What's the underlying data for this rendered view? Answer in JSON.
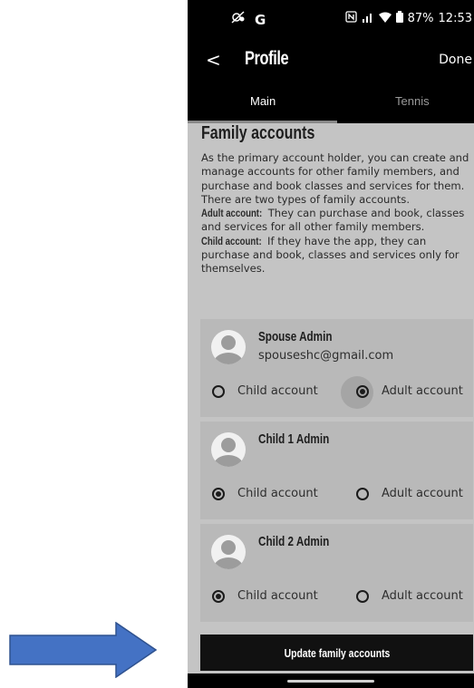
{
  "status_bar": {
    "left_icons": [
      "notification-muted-icon",
      "google-icon"
    ],
    "google_letter": "G",
    "battery": "87%",
    "time": "12:53"
  },
  "header": {
    "back_glyph": "<",
    "title": "Profile",
    "done_label": "Done"
  },
  "tabs": [
    {
      "label": "Main",
      "active": true
    },
    {
      "label": "Tennis",
      "active": false
    }
  ],
  "family": {
    "title": "Family accounts",
    "intro": "As the primary account holder, you can create and manage accounts for other family members, and purchase and book classes and services for them. There are two types of family accounts.",
    "adult_label": "Adult account:",
    "adult_text": "They can purchase and book, classes and services for all other family members.",
    "child_label": "Child account:",
    "child_text": "If they have the app, they can purchase and book, classes and services only for themselves."
  },
  "members": [
    {
      "name": "Spouse Admin",
      "email": "spouseshc@gmail.com",
      "child_option": "Child account",
      "adult_option": "Adult account",
      "selected": "adult"
    },
    {
      "name": "Child 1 Admin",
      "email": "",
      "child_option": "Child account",
      "adult_option": "Adult account",
      "selected": "child"
    },
    {
      "name": "Child 2 Admin",
      "email": "",
      "child_option": "Child account",
      "adult_option": "Adult account",
      "selected": "child"
    }
  ],
  "actions": {
    "update_label": "Update family accounts"
  },
  "colors": {
    "arrow": "#4472c4",
    "arrow_border": "#2f528f",
    "background": "#c4c4c4",
    "card": "#b9b9b9",
    "header": "#000000"
  }
}
